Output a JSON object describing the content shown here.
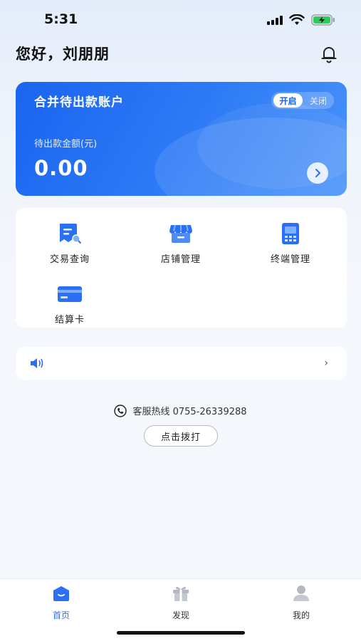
{
  "status_bar": {
    "time": "5:31"
  },
  "header": {
    "greeting": "您好，刘朋朋"
  },
  "account_card": {
    "title": "合并待出款账户",
    "toggle_on": "开启",
    "toggle_off": "关闭",
    "amount_label": "待出款金额(元)",
    "amount": "0.00"
  },
  "menu": {
    "items": [
      {
        "label": "交易查询",
        "icon": "transaction-query-icon"
      },
      {
        "label": "店铺管理",
        "icon": "store-icon"
      },
      {
        "label": "终端管理",
        "icon": "terminal-icon"
      },
      {
        "label": "结算卡",
        "icon": "bank-card-icon"
      }
    ]
  },
  "notice": {
    "icon": "speaker-icon",
    "chevron": "›"
  },
  "hotline": {
    "text": "客服热线 0755-26339288",
    "call_label": "点击拨打"
  },
  "tab_bar": {
    "tabs": [
      {
        "label": "首页",
        "icon": "home-icon"
      },
      {
        "label": "发现",
        "icon": "gift-icon"
      },
      {
        "label": "我的",
        "icon": "user-icon"
      }
    ]
  },
  "colors": {
    "accent": "#2a6ff4",
    "card_start": "#1a64f0",
    "card_end": "#4b93fb"
  }
}
